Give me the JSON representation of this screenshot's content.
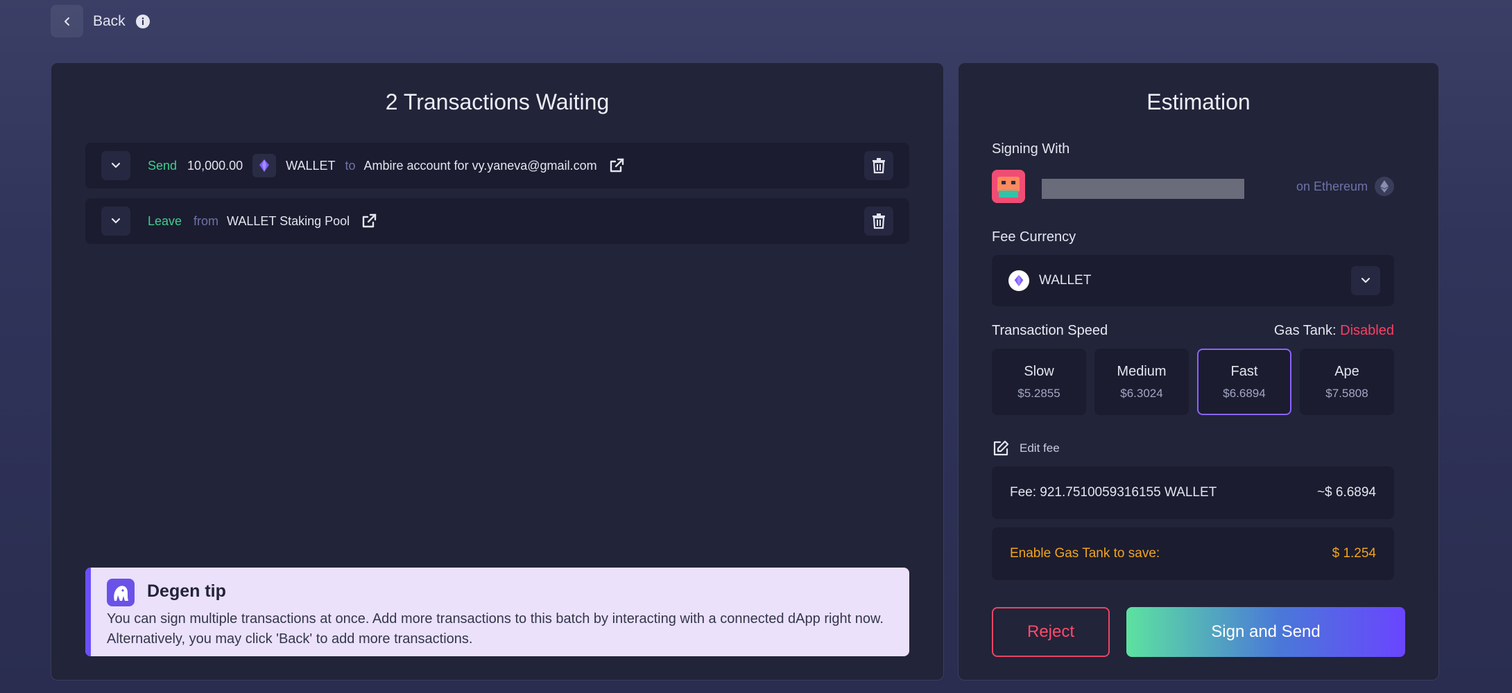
{
  "header": {
    "back_label": "Back"
  },
  "transactions": {
    "title": "2 Transactions Waiting",
    "rows": [
      {
        "action": "Send",
        "amount": "10,000.00",
        "token": "WALLET",
        "preposition": "to",
        "target": "Ambire account for vy.yaneva@gmail.com"
      },
      {
        "action": "Leave",
        "preposition": "from",
        "target": "WALLET Staking Pool"
      }
    ]
  },
  "tip": {
    "title": "Degen tip",
    "text": "You can sign multiple transactions at once. Add more transactions to this batch by interacting with a connected dApp right now. Alternatively, you may click 'Back' to add more transactions."
  },
  "estimation": {
    "title": "Estimation",
    "signing_with_label": "Signing With",
    "network": "on Ethereum",
    "fee_currency_label": "Fee Currency",
    "fee_currency_value": "WALLET",
    "speed_label": "Transaction Speed",
    "gas_tank_label": "Gas Tank:",
    "gas_tank_status": "Disabled",
    "speeds": [
      {
        "name": "Slow",
        "price": "$5.2855"
      },
      {
        "name": "Medium",
        "price": "$6.3024"
      },
      {
        "name": "Fast",
        "price": "$6.6894"
      },
      {
        "name": "Ape",
        "price": "$7.5808"
      }
    ],
    "selected_speed": "Fast",
    "edit_fee_label": "Edit fee",
    "fee_text": "Fee: 921.7510059316155 WALLET",
    "fee_usd": "~$ 6.6894",
    "save_text": "Enable Gas Tank to save:",
    "save_amount": "$ 1.254",
    "reject_label": "Reject",
    "sign_label": "Sign and Send"
  },
  "colors": {
    "accent_green": "#3fcf8e",
    "danger": "#ff3e63",
    "warning": "#f2a41c",
    "selected_border": "#8a63ff"
  }
}
